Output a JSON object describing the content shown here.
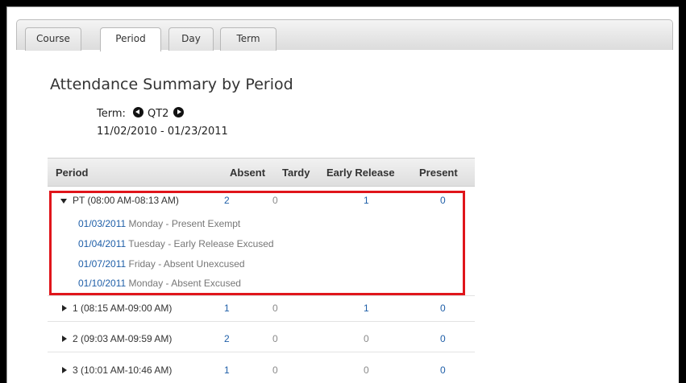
{
  "tabs": [
    {
      "label": "Course",
      "active": false
    },
    {
      "label": "Period",
      "active": true
    },
    {
      "label": "Day",
      "active": false
    },
    {
      "label": "Term",
      "active": false
    }
  ],
  "title": "Attendance Summary by Period",
  "term": {
    "label": "Term:",
    "value": "QT2",
    "date_range": "11/02/2010 - 01/23/2011",
    "prev_icon": "circle-arrow-left-icon",
    "next_icon": "circle-arrow-right-icon"
  },
  "table": {
    "columns": [
      "Period",
      "Absent",
      "Tardy",
      "Early Release",
      "Present"
    ],
    "rows": [
      {
        "period": "PT (08:00 AM-08:13 AM)",
        "absent": "2",
        "tardy": "0",
        "early_release": "1",
        "present": "0",
        "expanded": true,
        "details": [
          {
            "date": "01/03/2011",
            "text": "Monday - Present Exempt"
          },
          {
            "date": "01/04/2011",
            "text": "Tuesday - Early Release Excused"
          },
          {
            "date": "01/07/2011",
            "text": "Friday - Absent Unexcused"
          },
          {
            "date": "01/10/2011",
            "text": "Monday - Absent Excused"
          }
        ]
      },
      {
        "period": "1 (08:15 AM-09:00 AM)",
        "absent": "1",
        "tardy": "0",
        "early_release": "1",
        "present": "0",
        "expanded": false
      },
      {
        "period": "2 (09:03 AM-09:59 AM)",
        "absent": "2",
        "tardy": "0",
        "early_release": "0",
        "present": "0",
        "expanded": false
      },
      {
        "period": "3 (10:01 AM-10:46 AM)",
        "absent": "1",
        "tardy": "0",
        "early_release": "0",
        "present": "0",
        "expanded": false
      }
    ]
  },
  "colors": {
    "link": "#1f5fa8",
    "highlight": "#e0151b",
    "zero": "#8a8a8a"
  }
}
